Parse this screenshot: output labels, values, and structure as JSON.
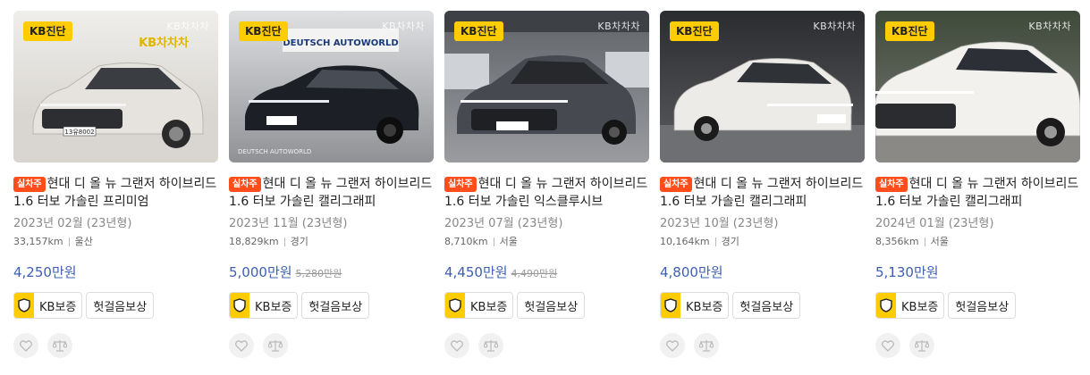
{
  "listings": [
    {
      "badge": "KB진단",
      "watermark": "KB차차차",
      "tag": "실차주",
      "title": "현대 디 올 뉴 그랜저 하이브리드 1.6 터보 가솔린 프리미엄",
      "date": "2023년 02월 (23년형)",
      "mileage": "33,157km",
      "region": "울산",
      "price": "4,250만원",
      "old_price": "",
      "kb_label": "KB보증",
      "extra_label": "헛걸음보상",
      "photo_sign": "KB차차차",
      "plate": "13유8002",
      "car_color": "#e6e3de",
      "bg_top": "#efeeeb",
      "bg_bottom": "#cfcbc5"
    },
    {
      "badge": "KB진단",
      "watermark": "KB차차차",
      "tag": "실차주",
      "title": "현대 디 올 뉴 그랜저 하이브리드 1.6 터보 가솔린 캘리그래피",
      "date": "2023년 11월 (23년형)",
      "mileage": "18,829km",
      "region": "경기",
      "price": "5,000만원",
      "old_price": "5,280만원",
      "kb_label": "KB보증",
      "extra_label": "헛걸음보상",
      "photo_sign": "DEUTSCH AUTOWORLD",
      "plate": "",
      "car_color": "#1c1f25",
      "bg_top": "#d9dadc",
      "bg_bottom": "#9a9ca0"
    },
    {
      "badge": "KB진단",
      "watermark": "KB차차차",
      "tag": "실차주",
      "title": "현대 디 올 뉴 그랜저 하이브리드 1.6 터보 가솔린 익스클루시브",
      "date": "2023년 07월 (23년형)",
      "mileage": "8,710km",
      "region": "서울",
      "price": "4,450만원",
      "old_price": "4,490만원",
      "kb_label": "KB보증",
      "extra_label": "헛걸음보상",
      "photo_sign": "",
      "plate": "",
      "car_color": "#464a50",
      "bg_top": "#6f7277",
      "bg_bottom": "#8d8f93"
    },
    {
      "badge": "KB진단",
      "watermark": "KB차차차",
      "tag": "실차주",
      "title": "현대 디 올 뉴 그랜저 하이브리드 1.6 터보 가솔린 캘리그래피",
      "date": "2023년 10월 (23년형)",
      "mileage": "10,164km",
      "region": "경기",
      "price": "4,800만원",
      "old_price": "",
      "kb_label": "KB보증",
      "extra_label": "헛걸음보상",
      "photo_sign": "",
      "plate": "",
      "car_color": "#ecebe8",
      "bg_top": "#2a2c30",
      "bg_bottom": "#5b5d60"
    },
    {
      "badge": "KB진단",
      "watermark": "KB차차차",
      "tag": "실차주",
      "title": "현대 디 올 뉴 그랜저 하이브리드 1.6 터보 가솔린 캘리그래피",
      "date": "2024년 01월 (23년형)",
      "mileage": "8,356km",
      "region": "서울",
      "price": "5,130만원",
      "old_price": "",
      "kb_label": "KB보증",
      "extra_label": "헛걸음보상",
      "photo_sign": "",
      "plate": "",
      "car_color": "#f2f1ee",
      "bg_top": "#3e4a3a",
      "bg_bottom": "#7d7c78"
    }
  ]
}
